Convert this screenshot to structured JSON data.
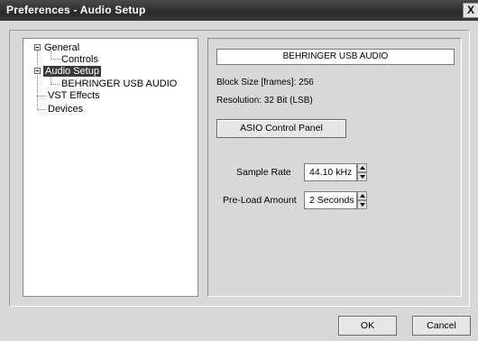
{
  "window": {
    "title": "Preferences - Audio Setup",
    "close_glyph": "X"
  },
  "tree": {
    "items": [
      {
        "label": "General",
        "expanded": true
      },
      {
        "label": "Controls"
      },
      {
        "label": "Audio Setup",
        "expanded": true,
        "selected": true
      },
      {
        "label": "BEHRINGER USB AUDIO"
      },
      {
        "label": "VST Effects"
      },
      {
        "label": "Devices"
      }
    ]
  },
  "panel": {
    "device_name": "BEHRINGER USB AUDIO",
    "block_size": "Block Size [frames]: 256",
    "resolution": "Resolution: 32 Bit (LSB)",
    "asio_button": "ASIO Control Panel",
    "sample_rate_label": "Sample Rate",
    "sample_rate_value": "44.10 kHz",
    "preload_label": "Pre-Load Amount",
    "preload_value": "2 Seconds"
  },
  "buttons": {
    "ok": "OK",
    "cancel": "Cancel"
  },
  "colors": {
    "titlebar": "#2f2f2f",
    "selection": "#3a3a3a",
    "dialog_bg": "#d8d8d8"
  }
}
